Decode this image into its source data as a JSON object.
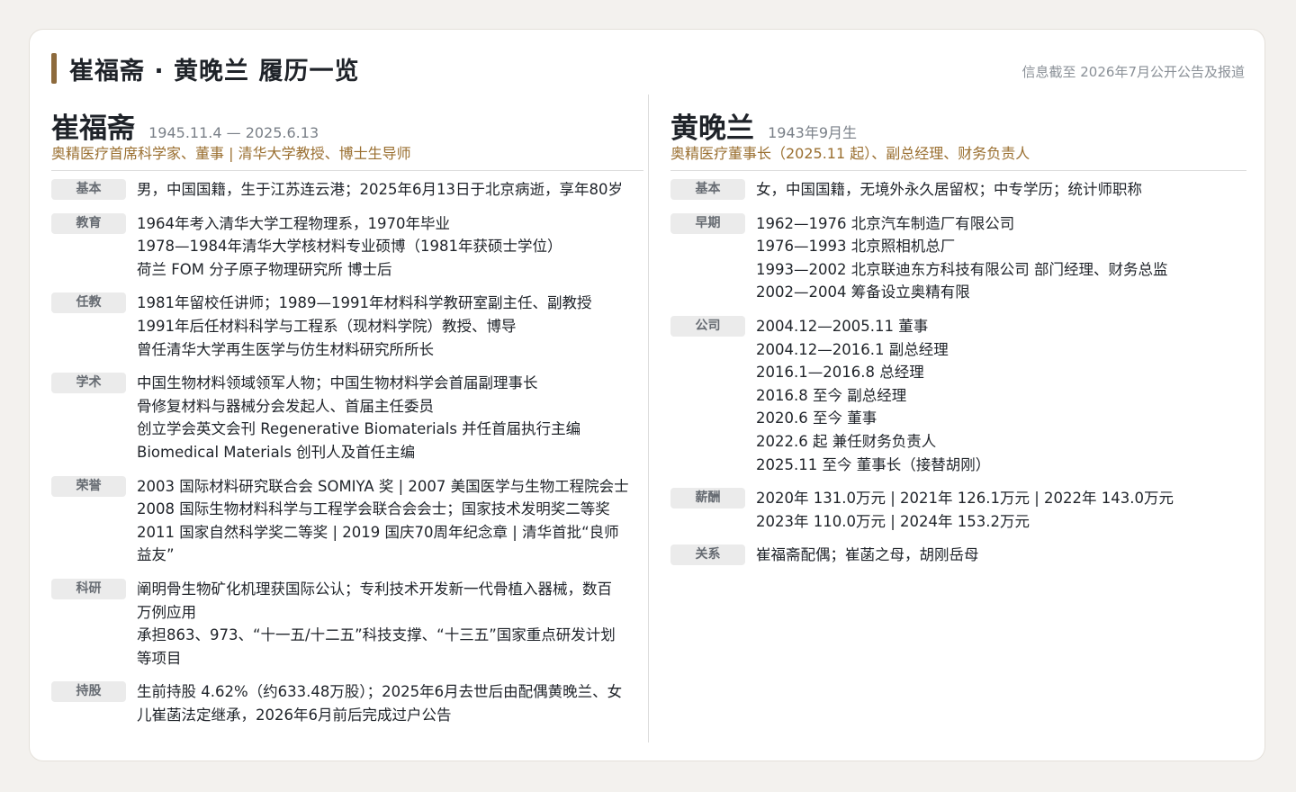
{
  "header": {
    "title": "崔福斋 · 黄晚兰 履历一览",
    "note": "信息截至 2026年7月公开公告及报道"
  },
  "colors": {
    "accent": "#8d6a3c",
    "role": "#9a6f30",
    "tag_bg": "#ebebeb"
  },
  "left": {
    "name": "崔福斋",
    "dates": "1945.11.4 — 2025.6.13",
    "role": "奥精医疗首席科学家、董事 | 清华大学教授、博士生导师",
    "sections": [
      {
        "tag": "基本",
        "lines": [
          "男，中国国籍，生于江苏连云港；2025年6月13日于北京病逝，享年80岁"
        ]
      },
      {
        "tag": "教育",
        "lines": [
          "1964年考入清华大学工程物理系，1970年毕业",
          "1978—1984年清华大学核材料专业硕博（1981年获硕士学位）",
          "荷兰 FOM 分子原子物理研究所 博士后"
        ]
      },
      {
        "tag": "任教",
        "lines": [
          "1981年留校任讲师；1989—1991年材料科学教研室副主任、副教授",
          "1991年后任材料科学与工程系（现材料学院）教授、博导",
          "曾任清华大学再生医学与仿生材料研究所所长"
        ]
      },
      {
        "tag": "学术",
        "lines": [
          "中国生物材料领域领军人物；中国生物材料学会首届副理事长",
          "骨修复材料与器械分会发起人、首届主任委员",
          "创立学会英文会刊 Regenerative Biomaterials 并任首届执行主编",
          "Biomedical Materials 创刊人及首任主编"
        ]
      },
      {
        "tag": "荣誉",
        "lines": [
          "2003 国际材料研究联合会 SOMIYA 奖 | 2007 美国医学与生物工程院会士",
          "2008 国际生物材料科学与工程学会联合会会士；国家技术发明奖二等奖",
          "2011 国家自然科学奖二等奖 | 2019 国庆70周年纪念章 | 清华首批“良师",
          "益友”"
        ]
      },
      {
        "tag": "科研",
        "lines": [
          "阐明骨生物矿化机理获国际公认；专利技术开发新一代骨植入器械，数百",
          "万例应用",
          "承担863、973、“十一五/十二五”科技支撑、“十三五”国家重点研发计划",
          "等项目"
        ]
      },
      {
        "tag": "持股",
        "lines": [
          "生前持股 4.62%（约633.48万股）；2025年6月去世后由配偶黄晚兰、女",
          "儿崔菡法定继承，2026年6月前后完成过户公告"
        ]
      }
    ]
  },
  "right": {
    "name": "黄晚兰",
    "dates": "1943年9月生",
    "role": "奥精医疗董事长（2025.11 起）、副总经理、财务负责人",
    "sections": [
      {
        "tag": "基本",
        "lines": [
          "女，中国国籍，无境外永久居留权；中专学历；统计师职称"
        ]
      },
      {
        "tag": "早期",
        "lines": [
          "1962—1976 北京汽车制造厂有限公司",
          "1976—1993 北京照相机总厂",
          "1993—2002 北京联迪东方科技有限公司 部门经理、财务总监",
          "2002—2004 筹备设立奥精有限"
        ]
      },
      {
        "tag": "公司",
        "lines": [
          "2004.12—2005.11 董事",
          "2004.12—2016.1 副总经理",
          "2016.1—2016.8 总经理",
          "2016.8 至今 副总经理",
          "2020.6 至今 董事",
          "2022.6 起 兼任财务负责人",
          "2025.11 至今 董事长（接替胡刚）"
        ]
      },
      {
        "tag": "薪酬",
        "lines": [
          "2020年 131.0万元 | 2021年 126.1万元 | 2022年 143.0万元",
          "2023年 110.0万元 | 2024年 153.2万元"
        ]
      },
      {
        "tag": "关系",
        "lines": [
          "崔福斋配偶；崔菡之母，胡刚岳母"
        ]
      }
    ]
  }
}
